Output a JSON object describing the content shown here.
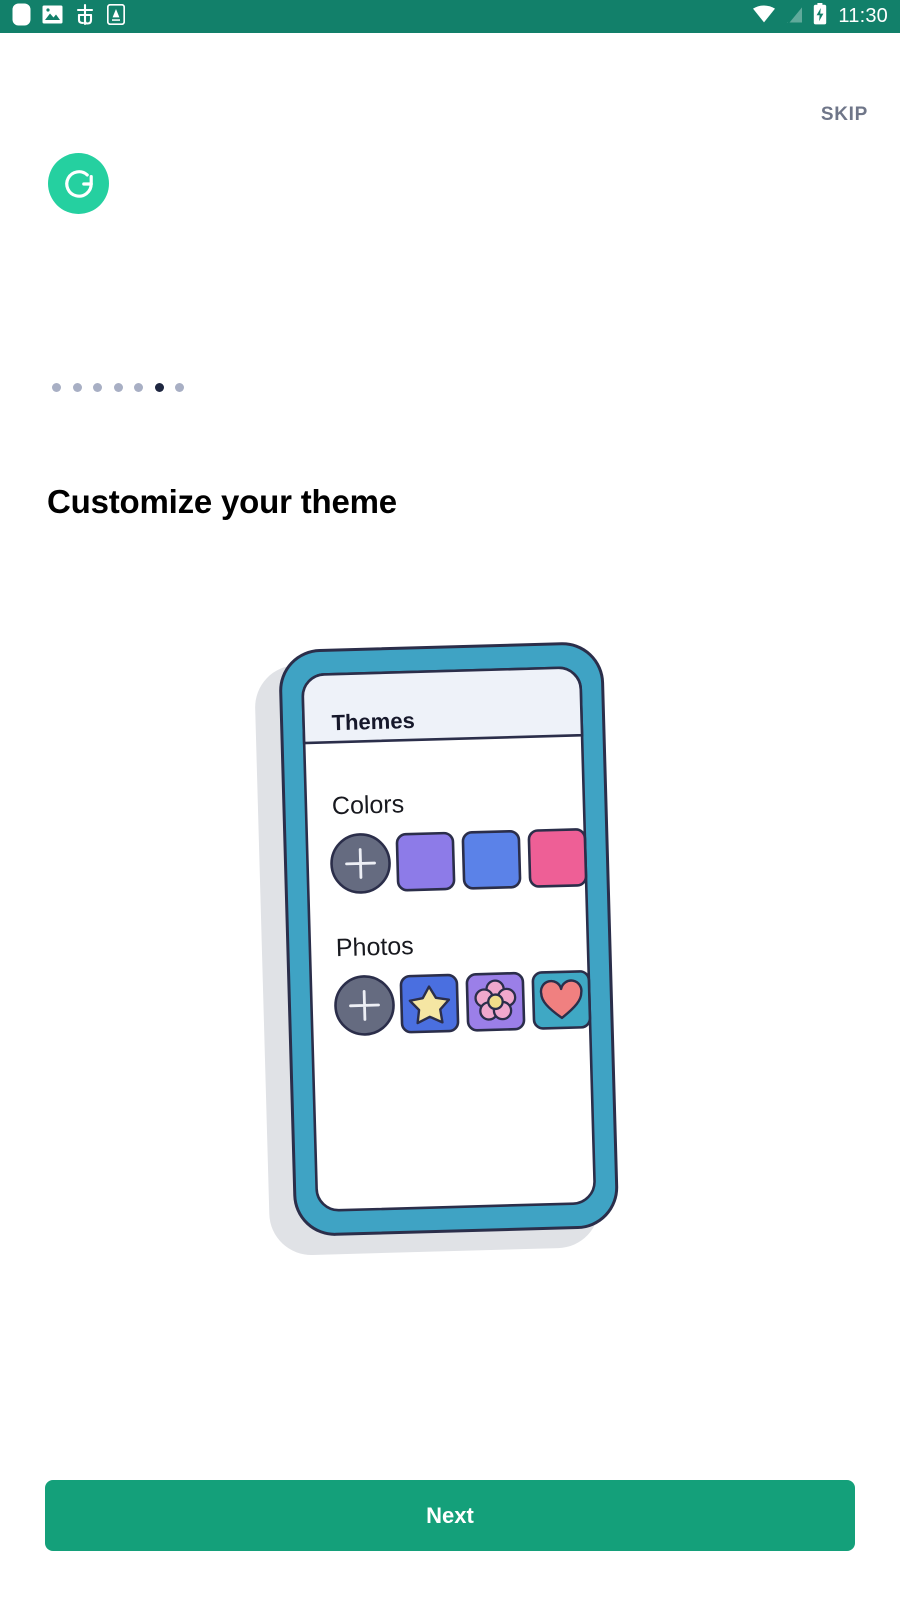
{
  "status_bar": {
    "background": "#12806A",
    "time": "11:30",
    "left_icons": [
      {
        "name": "rounded-square-icon",
        "glyph": "rounded-square"
      },
      {
        "name": "image-icon",
        "glyph": "picture"
      },
      {
        "name": "debug-bug-icon",
        "glyph": "bug"
      },
      {
        "name": "letter-a-icon",
        "glyph": "A"
      }
    ],
    "right_icons": [
      {
        "name": "wifi-icon",
        "glyph": "wifi"
      },
      {
        "name": "signal-off-icon",
        "glyph": "signal-slash"
      },
      {
        "name": "battery-charging-icon",
        "glyph": "battery-bolt"
      }
    ]
  },
  "header": {
    "skip_label": "SKIP",
    "skip_color": "#6F7689",
    "logo_name": "app-logo",
    "logo_bg": "#25D0A0"
  },
  "pager": {
    "total": 7,
    "active_index": 5,
    "inactive_color": "#A8AFC4",
    "active_color": "#1E2640"
  },
  "main": {
    "title": "Customize your theme"
  },
  "illustration": {
    "name": "phone-themes-illustration",
    "frame_color": "#3FA3C4",
    "shadow_color": "#E0E2E6",
    "screen_color": "#FFFFFF",
    "outline_color": "#2B2E4A",
    "appbar": {
      "title": "Themes",
      "background": "#EEF2F9"
    },
    "sections": [
      {
        "label": "Colors",
        "add_button": {
          "name": "add-color-button",
          "fill": "#656B80",
          "glyph": "+"
        },
        "swatches": [
          {
            "name": "color-swatch-purple",
            "fill": "#8D7BE8"
          },
          {
            "name": "color-swatch-blue",
            "fill": "#5B82E8"
          },
          {
            "name": "color-swatch-pink",
            "fill": "#EE5F96"
          }
        ]
      },
      {
        "label": "Photos",
        "add_button": {
          "name": "add-photo-button",
          "fill": "#656B80",
          "glyph": "+"
        },
        "tiles": [
          {
            "name": "photo-tile-star",
            "bg": "#4A6FE0",
            "shape": "star",
            "shape_fill": "#F5E6A3"
          },
          {
            "name": "photo-tile-flower",
            "bg": "#9B7FE8",
            "shape": "flower",
            "shape_fill": "#F0A8CC",
            "accent": "#F2DE8A"
          },
          {
            "name": "photo-tile-heart",
            "bg": "#3FA8C4",
            "shape": "heart",
            "shape_fill": "#F08080"
          }
        ]
      }
    ]
  },
  "footer": {
    "next_label": "Next",
    "next_color": "#14A07A"
  }
}
